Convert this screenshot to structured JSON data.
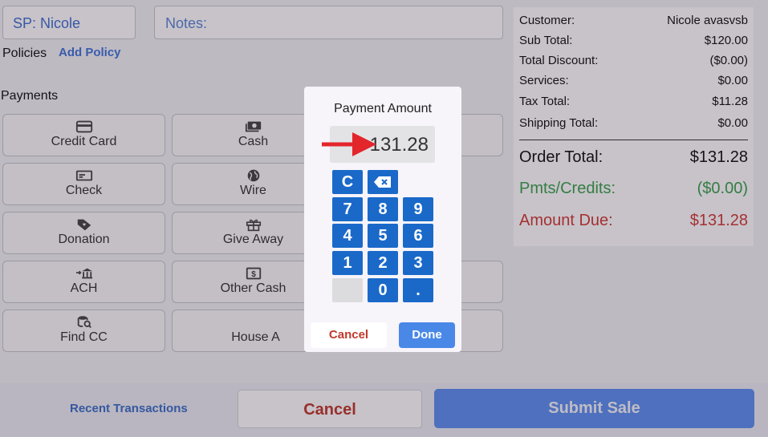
{
  "header": {
    "sp_label": "SP: Nicole",
    "notes_placeholder": "Notes:"
  },
  "policies": {
    "label": "Policies",
    "add_label": "Add Policy"
  },
  "payments": {
    "title": "Payments",
    "buttons": [
      {
        "label": "Credit Card",
        "icon": "credit-card-icon"
      },
      {
        "label": "Cash",
        "icon": "cash-icon"
      },
      {
        "label": "Check",
        "icon": "check-icon"
      },
      {
        "label": "Wire",
        "icon": "globe-icon"
      },
      {
        "label": "Donation",
        "icon": "heart-tag-icon"
      },
      {
        "label": "Give Away",
        "icon": "gift-icon"
      },
      {
        "label": "ACH",
        "icon": "bank-transfer-icon"
      },
      {
        "label": "Other Cash",
        "icon": "dollar-bill-icon"
      },
      {
        "label": "Find CC",
        "icon": "coin-search-icon"
      },
      {
        "label": "House A",
        "icon": ""
      }
    ]
  },
  "summary": {
    "customer_label": "Customer:",
    "customer_value": "Nicole avasvsb",
    "subtotal_label": "Sub Total:",
    "subtotal_value": "$120.00",
    "discount_label": "Total Discount:",
    "discount_value": "($0.00)",
    "services_label": "Services:",
    "services_value": "$0.00",
    "tax_label": "Tax Total:",
    "tax_value": "$11.28",
    "shipping_label": "Shipping Total:",
    "shipping_value": "$0.00",
    "order_total_label": "Order Total:",
    "order_total_value": "$131.28",
    "pmts_label": "Pmts/Credits:",
    "pmts_value": "($0.00)",
    "amount_due_label": "Amount Due:",
    "amount_due_value": "$131.28"
  },
  "footer": {
    "recent_label": "Recent Transactions",
    "cancel_label": "Cancel",
    "submit_label": "Submit Sale"
  },
  "modal": {
    "title": "Payment Amount",
    "amount": "131.28",
    "keys": {
      "clear": "C",
      "k7": "7",
      "k8": "8",
      "k9": "9",
      "k4": "4",
      "k5": "5",
      "k6": "6",
      "k1": "1",
      "k2": "2",
      "k3": "3",
      "k0": "0",
      "dot": "."
    },
    "cancel_label": "Cancel",
    "done_label": "Done"
  },
  "colors": {
    "accent": "#3f74d8",
    "key_blue": "#1a69c9",
    "green": "#3aa14b",
    "red": "#d03a34",
    "arrow_red": "#e3262b"
  }
}
